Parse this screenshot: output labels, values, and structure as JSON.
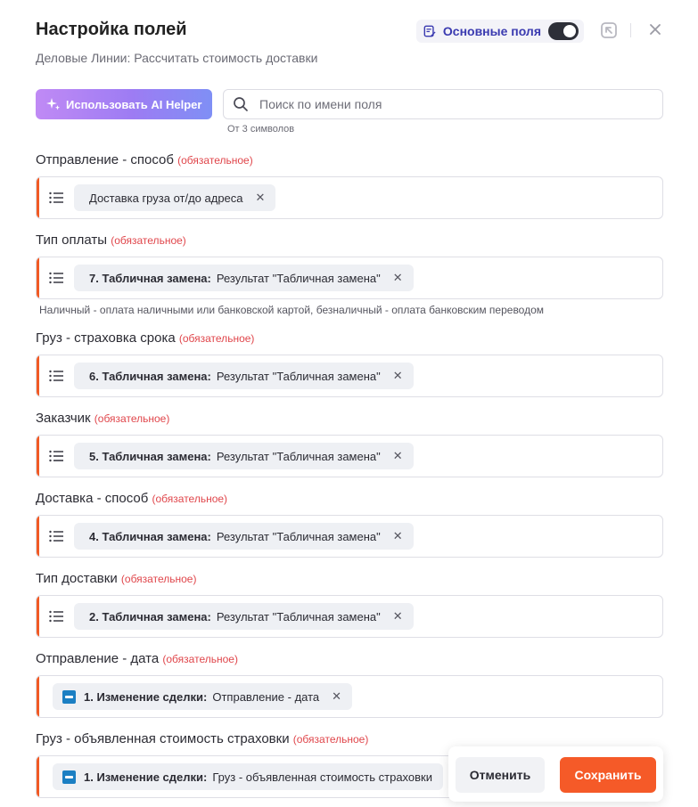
{
  "header": {
    "title": "Настройка полей",
    "subtitle": "Деловые Линии: Рассчитать стоимость доставки",
    "basic_fields_label": "Основные поля",
    "basic_fields_enabled": true
  },
  "toolbar": {
    "ai_helper_label": "Использовать AI Helper",
    "search_placeholder": "Поиск по имени поля",
    "search_hint": "От 3 символов"
  },
  "required_label": "(обязательное)",
  "fields": [
    {
      "label": "Отправление - способ",
      "chip_source": "",
      "chip_value": "Доставка груза от/до адреса",
      "note": ""
    },
    {
      "label": "Тип оплаты",
      "chip_source": "7. Табличная замена:",
      "chip_value": "Результат \"Табличная замена\"",
      "note": "Наличный - оплата наличными или банковской картой, безналичный - оплата банковским переводом"
    },
    {
      "label": "Груз - страховка срока",
      "chip_source": "6. Табличная замена:",
      "chip_value": "Результат \"Табличная замена\"",
      "note": ""
    },
    {
      "label": "Заказчик",
      "chip_source": "5. Табличная замена:",
      "chip_value": "Результат \"Табличная замена\"",
      "note": ""
    },
    {
      "label": "Доставка - способ",
      "chip_source": "4. Табличная замена:",
      "chip_value": "Результат \"Табличная замена\"",
      "note": ""
    },
    {
      "label": "Тип доставки",
      "chip_source": "2. Табличная замена:",
      "chip_value": "Результат \"Табличная замена\"",
      "note": ""
    },
    {
      "label": "Отправление - дата",
      "chip_source": "1. Изменение сделки:",
      "chip_value": "Отправление - дата",
      "note": ""
    },
    {
      "label": "Груз - объявленная стоимость страховки",
      "chip_source": "1. Изменение сделки:",
      "chip_value": "Груз - объявленная стоимость страховки",
      "note": ""
    }
  ],
  "footer": {
    "cancel_label": "Отменить",
    "save_label": "Сохранить"
  },
  "colors": {
    "accent": "#f55a28",
    "required": "#e0464b",
    "toggle_label": "#3a3ab0"
  }
}
